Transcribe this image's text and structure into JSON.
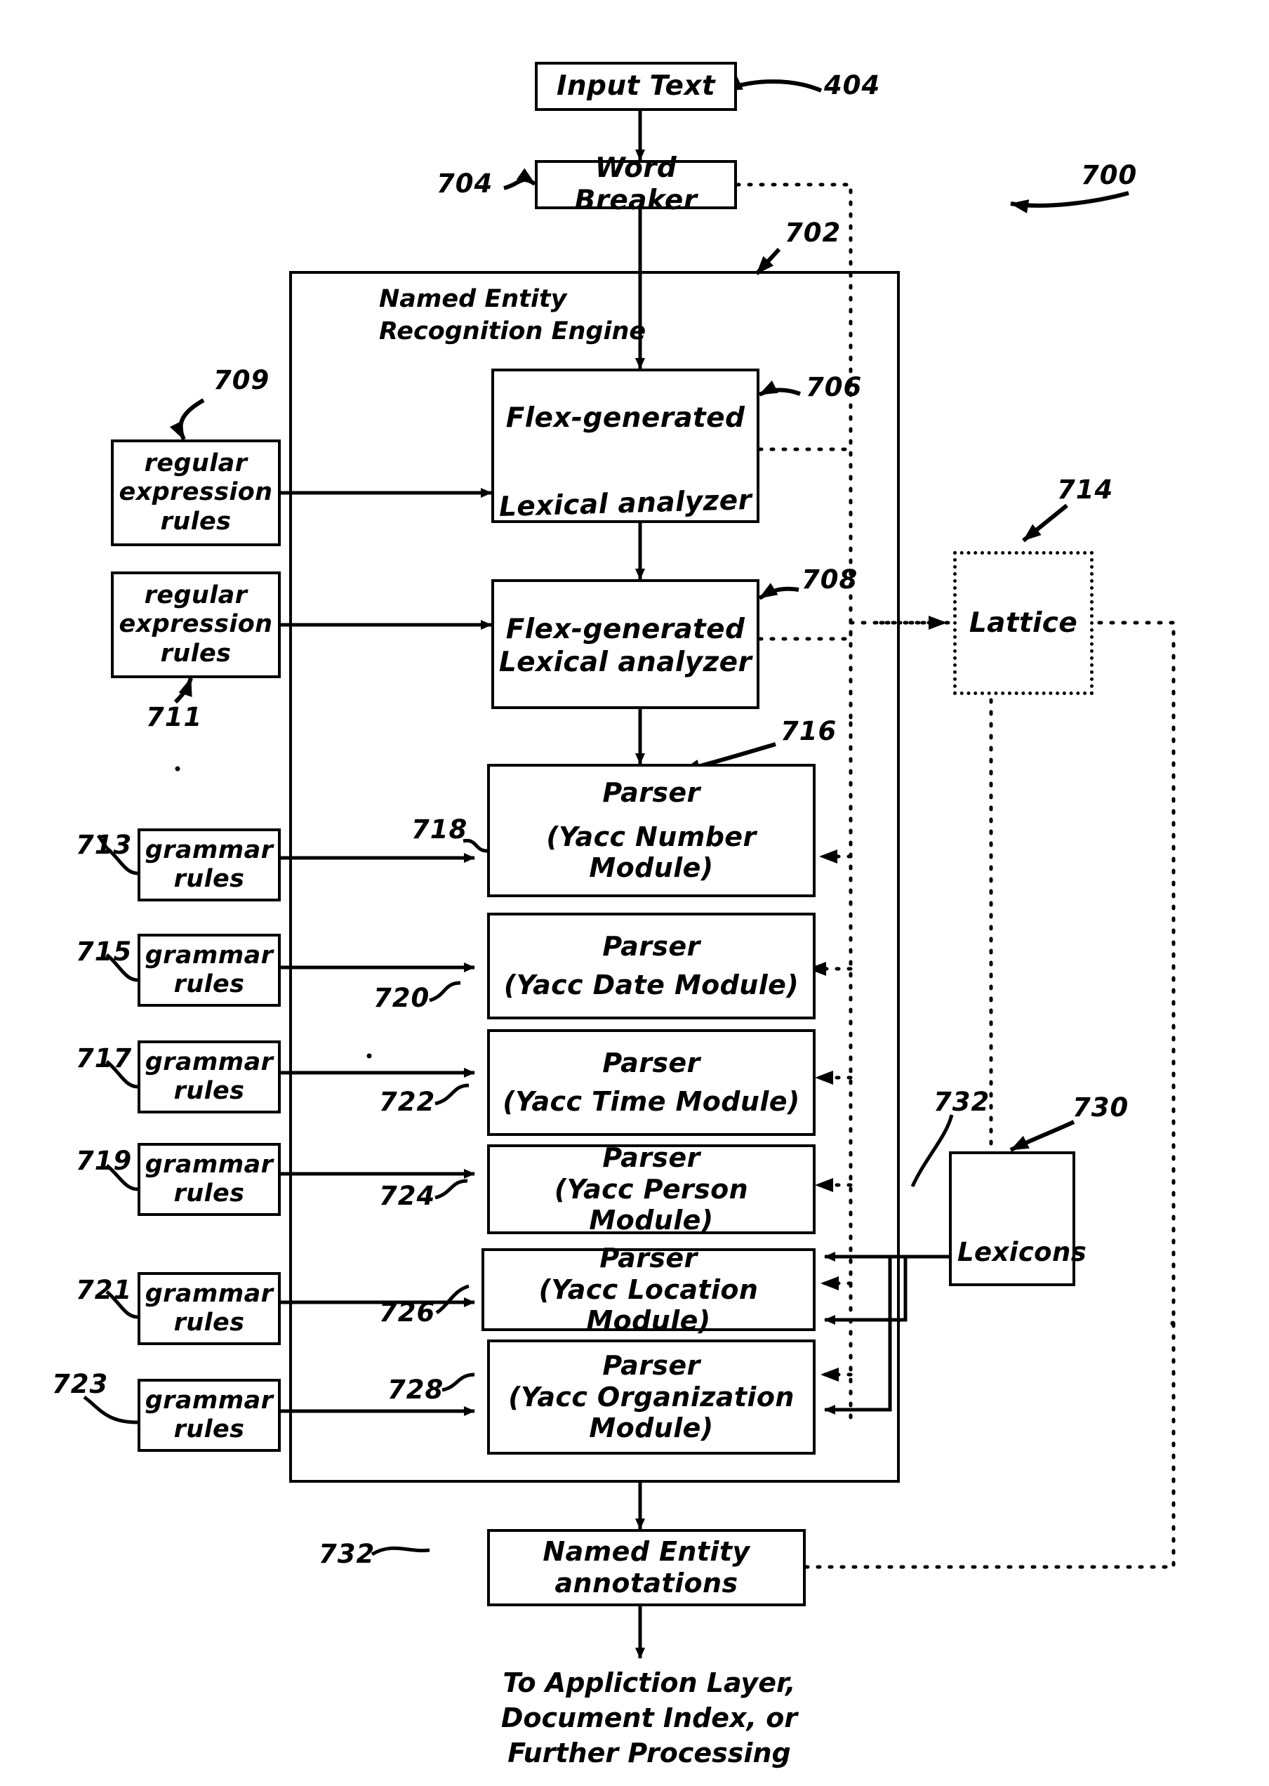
{
  "figure": {
    "id": "700",
    "engine_title": "Named Entity\nRecognition Engine",
    "engine_ref": "702"
  },
  "nodes": {
    "input_text": {
      "label": "Input Text",
      "ref": "404"
    },
    "word_breaker": {
      "label": "Word Breaker",
      "ref": "704"
    },
    "lex1_line1": {
      "label": "Flex-generated"
    },
    "lex1_line2": {
      "label": "Lexical analyzer",
      "ref": "706"
    },
    "lex2_line1": {
      "label": "Flex-generated"
    },
    "lex2_line2": {
      "label": "Lexical analyzer",
      "ref": "708"
    },
    "lattice": {
      "label": "Lattice",
      "ref": "714"
    },
    "lexicons": {
      "label": "Lexicons",
      "ref": "730"
    },
    "lexicons_ref2": {
      "label": "732"
    },
    "annotations_l1": {
      "label": "Named Entity"
    },
    "annotations_l2": {
      "label": "annotations",
      "ref": "732"
    },
    "parsers_group_ref": "716",
    "regex_rules_1": {
      "l1": "regular",
      "l2": "expression",
      "l3": "rules",
      "ref": "709"
    },
    "regex_rules_2": {
      "l1": "regular",
      "l2": "expression",
      "l3": "rules",
      "ref": "711"
    }
  },
  "grammar_rules": [
    {
      "l1": "grammar",
      "l2": "rules",
      "ref": "713"
    },
    {
      "l1": "grammar",
      "l2": "rules",
      "ref": "715"
    },
    {
      "l1": "grammar",
      "l2": "rules",
      "ref": "717"
    },
    {
      "l1": "grammar",
      "l2": "rules",
      "ref": "719"
    },
    {
      "l1": "grammar",
      "l2": "rules",
      "ref": "721"
    },
    {
      "l1": "grammar",
      "l2": "rules",
      "ref": "723"
    }
  ],
  "parsers": [
    {
      "l1": "Parser",
      "l2": "(Yacc Number Module)",
      "l3": "",
      "ref": "718"
    },
    {
      "l1": "Parser",
      "l2": "(Yacc Date Module)",
      "l3": "",
      "ref": "720"
    },
    {
      "l1": "Parser",
      "l2": "(Yacc Time Module)",
      "l3": "",
      "ref": "722"
    },
    {
      "l1": "Parser",
      "l2": "(Yacc Person Module)",
      "l3": "",
      "ref": "724"
    },
    {
      "l1": "Parser",
      "l2": "(Yacc Location Module)",
      "l3": "",
      "ref": "726"
    },
    {
      "l1": "Parser",
      "l2": "(Yacc Organization",
      "l3": "Module)",
      "ref": "728"
    }
  ],
  "footer": {
    "line1": "To Appliction Layer,",
    "line2": "Document Index, or",
    "line3": "Further Processing"
  },
  "colors": {
    "ink": "#000000",
    "paper": "#ffffff"
  }
}
